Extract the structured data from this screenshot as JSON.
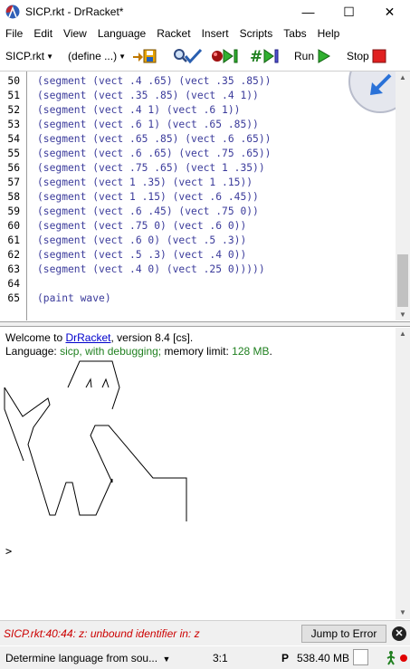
{
  "window": {
    "title": "SICP.rkt - DrRacket*",
    "minimize": "—",
    "maximize": "☐",
    "close": "✕"
  },
  "menu": [
    "File",
    "Edit",
    "View",
    "Language",
    "Racket",
    "Insert",
    "Scripts",
    "Tabs",
    "Help"
  ],
  "toolbar": {
    "file_selector": "SICP.rkt",
    "define_selector": "(define ...)",
    "run_label": "Run",
    "stop_label": "Stop"
  },
  "editor": {
    "lines": [
      {
        "num": "50",
        "text": "(segment (vect .4 .65) (vect .35 .85))"
      },
      {
        "num": "51",
        "text": "(segment (vect .35 .85) (vect .4 1))"
      },
      {
        "num": "52",
        "text": "(segment (vect .4 1) (vect .6 1))"
      },
      {
        "num": "53",
        "text": "(segment (vect .6 1) (vect .65 .85))"
      },
      {
        "num": "54",
        "text": "(segment (vect .65 .85) (vect .6 .65))"
      },
      {
        "num": "55",
        "text": "(segment (vect .6 .65) (vect .75 .65))"
      },
      {
        "num": "56",
        "text": "(segment (vect .75 .65) (vect 1 .35))"
      },
      {
        "num": "57",
        "text": "(segment (vect 1 .35) (vect 1 .15))"
      },
      {
        "num": "58",
        "text": "(segment (vect 1 .15) (vect .6 .45))"
      },
      {
        "num": "59",
        "text": "(segment (vect .6 .45) (vect .75 0))"
      },
      {
        "num": "60",
        "text": "(segment (vect .75 0) (vect .6 0))"
      },
      {
        "num": "61",
        "text": "(segment (vect .6 0) (vect .5 .3))"
      },
      {
        "num": "62",
        "text": "(segment (vect .5 .3) (vect .4 0))"
      },
      {
        "num": "63",
        "text": "(segment (vect .4 0) (vect .25 0)))))"
      },
      {
        "num": "64",
        "text": ""
      },
      {
        "num": "65",
        "text": "(paint wave)"
      }
    ]
  },
  "interactions": {
    "welcome_prefix": "Welcome to ",
    "welcome_link": "DrRacket",
    "welcome_suffix": ", version 8.4 [cs].",
    "language_prefix": "Language: ",
    "language_name": "sicp, with debugging;",
    "memory_prefix": " memory limit: ",
    "memory_value": "128 MB",
    "memory_suffix": ".",
    "prompt": ">"
  },
  "error": {
    "message": "SICP.rkt:40:44: z: unbound identifier in: z",
    "jump_label": "Jump to Error",
    "close": "✕"
  },
  "status": {
    "language": "Determine language from sou...",
    "language_arrow": "▼",
    "position": "3:1",
    "p_indicator": "P",
    "memory": "538.40 MB"
  },
  "colors": {
    "code_text": "#3b3b9b",
    "error_text": "#cc0000",
    "language_green": "#208020",
    "link": "#0000cc"
  }
}
